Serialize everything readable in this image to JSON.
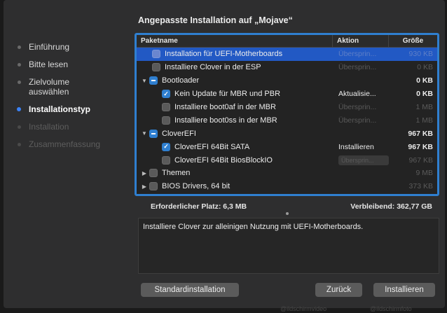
{
  "sidebar": {
    "steps": [
      {
        "label": "Einführung",
        "state": "done"
      },
      {
        "label": "Bitte lesen",
        "state": "done"
      },
      {
        "label": "Zielvolume auswählen",
        "state": "done"
      },
      {
        "label": "Installationstyp",
        "state": "active"
      },
      {
        "label": "Installation",
        "state": "disabled"
      },
      {
        "label": "Zusammenfassung",
        "state": "disabled"
      }
    ]
  },
  "main": {
    "title": "Angepasste Installation auf „Mojave“",
    "table": {
      "headers": {
        "name": "Paketname",
        "action": "Aktion",
        "size": "Größe"
      },
      "rows": [
        {
          "name": "Installation für UEFI-Motherboards",
          "action": "Übersprin...",
          "size": "930 KB",
          "checked": false,
          "selected": true
        },
        {
          "name": "Installiere Clover in der ESP",
          "action": "Übersprin...",
          "size": "0 KB",
          "checked": false
        },
        {
          "name": "Bootloader",
          "action": "",
          "size": "0 KB",
          "checked": "mixed",
          "group": true
        },
        {
          "name": "Kein Update für MBR und PBR",
          "action": "Aktualisie...",
          "size": "0 KB",
          "checked": true
        },
        {
          "name": "Installiere boot0af in der MBR",
          "action": "Übersprin...",
          "size": "1 MB",
          "checked": false
        },
        {
          "name": "Installiere boot0ss in der MBR",
          "action": "Übersprin...",
          "size": "1 MB",
          "checked": false
        },
        {
          "name": "CloverEFI",
          "action": "",
          "size": "967 KB",
          "checked": "mixed",
          "group": true
        },
        {
          "name": "CloverEFI 64Bit SATA",
          "action": "Installieren",
          "size": "967 KB",
          "checked": true
        },
        {
          "name": "CloverEFI 64Bit BiosBlockIO",
          "action": "Übersprin...",
          "size": "967 KB",
          "checked": false
        },
        {
          "name": "Themen",
          "action": "",
          "size": "9 MB",
          "checked": false,
          "group": true
        },
        {
          "name": "BIOS Drivers, 64 bit",
          "action": "",
          "size": "373 KB",
          "checked": false,
          "group": true
        }
      ]
    },
    "space": {
      "required": "Erforderlicher Platz:  6,3 MB",
      "remaining": "Verbleibend:  362,77 GB"
    },
    "description": "Installiere Clover zur alleinigen Nutzung mit UEFI-Motherboards."
  },
  "buttons": {
    "standard": "Standardinstallation",
    "back": "Zurück",
    "install": "Installieren"
  },
  "watermarks": [
    "@ildschirmvideo",
    "@ildschirmfoto"
  ],
  "colors": {
    "accent": "#2f7fd0",
    "selection": "#2259c4",
    "window": "#2e2e2f"
  }
}
